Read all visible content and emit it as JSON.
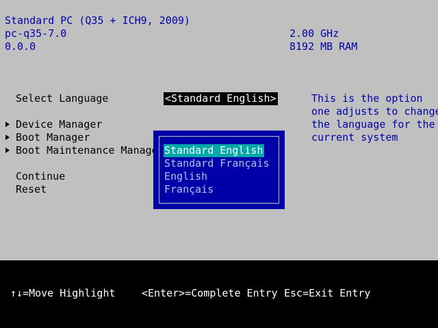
{
  "header": {
    "machine": "Standard PC (Q35 + ICH9, 2009)",
    "version": "pc-q35-7.0",
    "build": "0.0.0",
    "cpu_speed": "2.00 GHz",
    "memory": "8192 MB RAM"
  },
  "form": {
    "select_language_label": "Select Language",
    "select_language_value": "<Standard English>",
    "menu_items": [
      {
        "label": "Device Manager",
        "icon": "triangle-right-icon"
      },
      {
        "label": "Boot Manager",
        "icon": "triangle-right-icon"
      },
      {
        "label": "Boot Maintenance Manager",
        "icon": "triangle-right-icon"
      }
    ],
    "continue_label": "Continue",
    "reset_label": "Reset"
  },
  "help": {
    "lines": [
      "This is the option",
      "one adjusts to change",
      "the language for the",
      "current system"
    ]
  },
  "popup": {
    "options": [
      "Standard English",
      "Standard Français",
      "English",
      "Français"
    ],
    "selected_index": 0
  },
  "footer": {
    "move_highlight": "↑↓=Move Highlight",
    "complete_entry": "<Enter>=Complete Entry",
    "exit_entry": "Esc=Exit Entry"
  },
  "colors": {
    "background": "#c0c0c0",
    "header_text": "#0000a8",
    "popup_bg": "#0000a8",
    "selection_bg": "#00a8a8",
    "footer_bg": "#000000"
  }
}
